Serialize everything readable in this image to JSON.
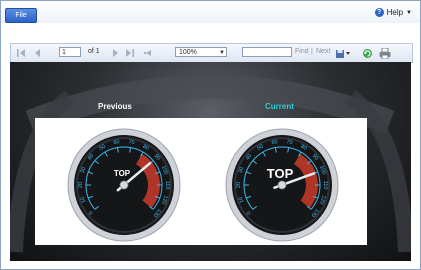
{
  "menu": {
    "file_label": "File",
    "help_label": "Help"
  },
  "toolbar": {
    "page_value": "1",
    "of_label": "of 1",
    "zoom_value": "100%",
    "find_value": "",
    "find_label": "Find",
    "separator": "|",
    "next_label": "Next"
  },
  "report": {
    "previous_label": "Previous",
    "current_label": "Current",
    "colors": {
      "previous": "#ffffff",
      "current": "#26d0d8",
      "scale": "#3fb6e8",
      "redzone": "#c0392b"
    }
  },
  "gauges": [
    {
      "name": "previous",
      "top_label": "TOP",
      "scale_labels": [
        "0",
        "10",
        "20",
        "30",
        "40",
        "50",
        "60",
        "70",
        "80",
        "90",
        "100",
        "110",
        "120",
        "130"
      ],
      "value": 90
    },
    {
      "name": "current",
      "top_label": "TOP",
      "scale_labels": [
        "0",
        "10",
        "20",
        "30",
        "40",
        "50",
        "60",
        "70",
        "80",
        "90",
        "100",
        "110",
        "120",
        "130"
      ],
      "value": 100
    }
  ],
  "icons": [
    "first-page-icon",
    "prev-page-icon",
    "next-page-icon",
    "last-page-icon",
    "back-icon",
    "export-icon",
    "refresh-icon",
    "print-icon",
    "help-icon"
  ]
}
